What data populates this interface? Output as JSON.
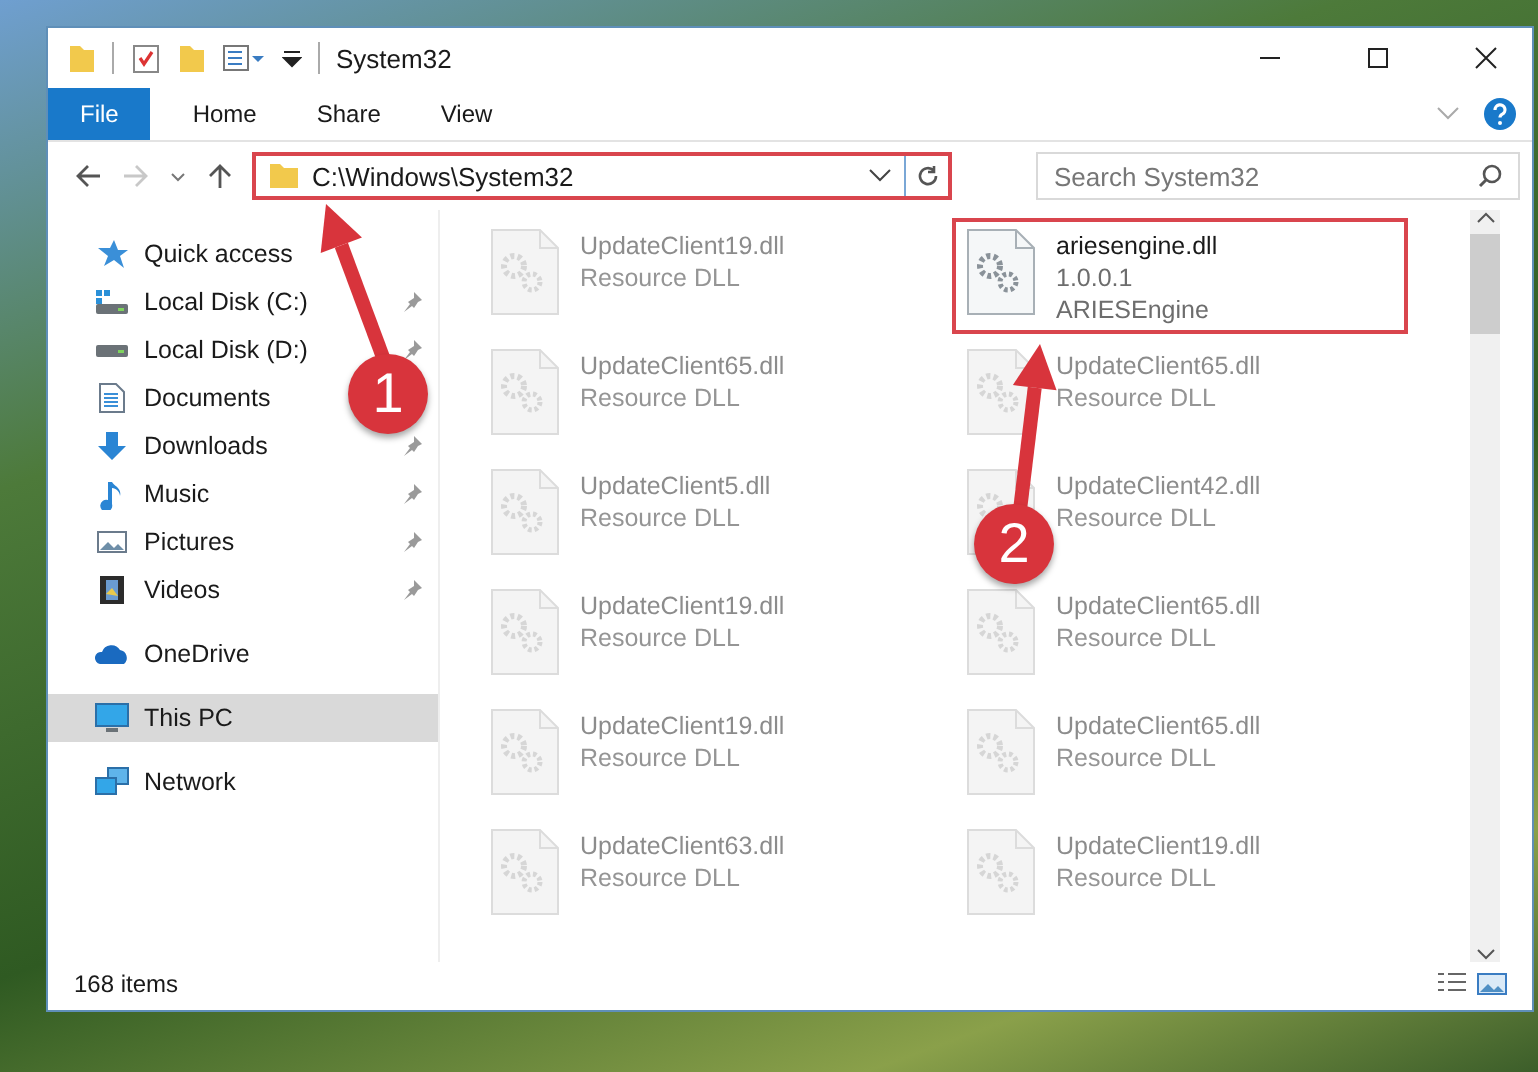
{
  "window": {
    "title": "System32"
  },
  "ribbon_tabs": [
    {
      "label": "File",
      "selected": true
    },
    {
      "label": "Home",
      "selected": false
    },
    {
      "label": "Share",
      "selected": false
    },
    {
      "label": "View",
      "selected": false
    }
  ],
  "address": {
    "path": "C:\\Windows\\System32",
    "highlighted": true
  },
  "search": {
    "placeholder": "Search System32"
  },
  "nav": [
    {
      "label": "Quick access",
      "selected": false,
      "children": [
        {
          "label": "Local Disk (C:)",
          "pinned": true,
          "selected": false
        },
        {
          "label": "Local Disk (D:)",
          "pinned": true,
          "selected": false
        },
        {
          "label": "Documents",
          "pinned": false,
          "selected": false
        },
        {
          "label": "Downloads",
          "pinned": true,
          "selected": false
        },
        {
          "label": "Music",
          "pinned": true,
          "selected": false
        },
        {
          "label": "Pictures",
          "pinned": true,
          "selected": false
        },
        {
          "label": "Videos",
          "pinned": true,
          "selected": false
        }
      ]
    },
    {
      "label": "OneDrive",
      "selected": false
    },
    {
      "label": "This PC",
      "selected": true
    },
    {
      "label": "Network",
      "selected": false
    }
  ],
  "files": [
    {
      "name": "UpdateClient19.dll",
      "details": [
        "Resource DLL"
      ],
      "blurred": true,
      "highlighted": false
    },
    {
      "name": "ariesengine.dll",
      "details": [
        "1.0.0.1",
        "ARIESEngine"
      ],
      "blurred": false,
      "highlighted": true
    },
    {
      "name": "UpdateClient65.dll",
      "details": [
        "Resource DLL"
      ],
      "blurred": true,
      "highlighted": false
    },
    {
      "name": "UpdateClient65.dll",
      "details": [
        "Resource DLL"
      ],
      "blurred": true,
      "highlighted": false
    },
    {
      "name": "UpdateClient5.dll",
      "details": [
        "Resource DLL"
      ],
      "blurred": true,
      "highlighted": false
    },
    {
      "name": "UpdateClient42.dll",
      "details": [
        "Resource DLL"
      ],
      "blurred": true,
      "highlighted": false
    },
    {
      "name": "UpdateClient19.dll",
      "details": [
        "Resource DLL"
      ],
      "blurred": true,
      "highlighted": false
    },
    {
      "name": "UpdateClient65.dll",
      "details": [
        "Resource DLL"
      ],
      "blurred": true,
      "highlighted": false
    },
    {
      "name": "UpdateClient19.dll",
      "details": [
        "Resource DLL"
      ],
      "blurred": true,
      "highlighted": false
    },
    {
      "name": "UpdateClient65.dll",
      "details": [
        "Resource DLL"
      ],
      "blurred": true,
      "highlighted": false
    },
    {
      "name": "UpdateClient63.dll",
      "details": [
        "Resource DLL"
      ],
      "blurred": true,
      "highlighted": false
    },
    {
      "name": "UpdateClient19.dll",
      "details": [
        "Resource DLL"
      ],
      "blurred": true,
      "highlighted": false
    }
  ],
  "status_bar": {
    "item_count": "168 items"
  },
  "annotations": [
    {
      "label": "1"
    },
    {
      "label": "2"
    }
  ]
}
